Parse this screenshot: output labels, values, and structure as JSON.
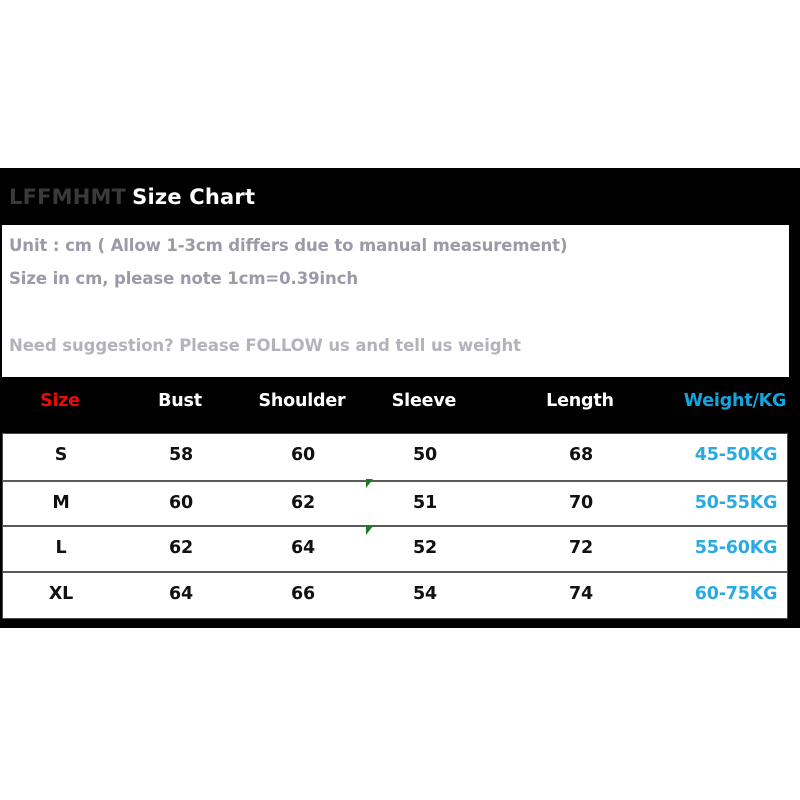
{
  "page": {
    "background": "#ffffff",
    "card_background": "#000000"
  },
  "header": {
    "brand": "LFFMHMT",
    "title": "Size Chart"
  },
  "info": {
    "lines": [
      "Unit : cm ( Allow 1-3cm differs due to manual measurement)",
      "Size in cm, please note 1cm=0.39inch",
      "Need suggestion? Please FOLLOW us and tell us weight"
    ]
  },
  "colors": {
    "size_header": "#e80d0d",
    "weight_header": "#12a5e0",
    "weight_value": "#29abe2",
    "brand_text": "#3b3a38",
    "title_text": "#ffffff",
    "info_text": "#9b9aa6",
    "marker_green": "#1f7a1f"
  },
  "chart_data": {
    "type": "table",
    "title": "LFFMHMT Size Chart",
    "notes": [
      "Unit : cm ( Allow 1-3cm differs due to manual measurement)",
      "Size in cm, please note 1cm=0.39inch",
      "Need suggestion? Please FOLLOW us and tell us weight"
    ],
    "columns": [
      "Size",
      "Bust",
      "Shoulder",
      "Sleeve",
      "Length",
      "Weight/KG"
    ],
    "rows": [
      [
        "S",
        "58",
        "60",
        "50",
        "68",
        "45-50KG"
      ],
      [
        "M",
        "60",
        "62",
        "51",
        "70",
        "50-55KG"
      ],
      [
        "L",
        "62",
        "64",
        "52",
        "72",
        "55-60KG"
      ],
      [
        "XL",
        "64",
        "66",
        "54",
        "74",
        "60-75KG"
      ]
    ],
    "units": "cm",
    "legend": "Weight column in KG"
  }
}
